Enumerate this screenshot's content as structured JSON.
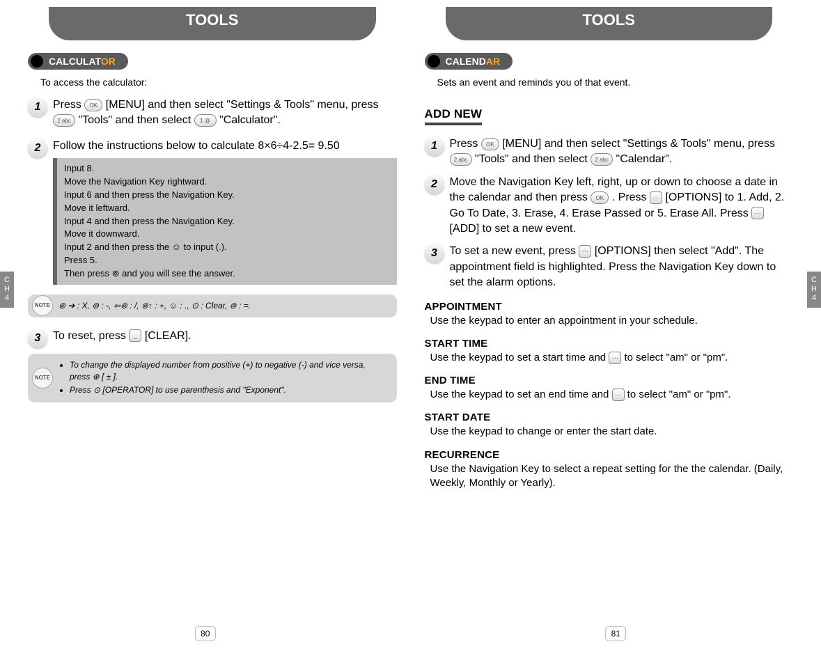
{
  "chapter_tab": "CH4",
  "left": {
    "header": "TOOLS",
    "section_label_a": "CALCULAT",
    "section_label_b": "OR",
    "intro": "To access the calculator:",
    "step1_a": "Press ",
    "step1_b": " [MENU] and then select \"Settings & Tools\" menu, press ",
    "step1_c": "\"Tools\" and then select ",
    "step1_d": "\"Calculator\".",
    "step2": "Follow the instructions below to calculate 8×6÷4-2.5= 9.50",
    "code": "Input 8.\nMove the Navigation Key rightward.\nInput 6 and then press the Navigation Key.\nMove it leftward.\nInput 4 and then press the Navigation Key.\nMove it downward.\nInput 2 and then press the ☺ to input (.).\nPress 5.\nThen press ⊚ and you will see the answer.",
    "note1": "⊚ ➔ : X,   ⊚ : -, ⇦⊚ : /,   ⊚↑ : +,  ☺ : .,  ⊙ : Clear,  ⊚ : =.",
    "step3_a": "To reset, press ",
    "step3_b": " [CLEAR].",
    "note2_bullet1": "To change the displayed number from positive (+) to negative (-) and vice versa, press ⊕ [ ± ].",
    "note2_bullet2": "Press  ⊙  [OPERATOR] to use parenthesis and \"Exponent\".",
    "page_num": "80",
    "key_ok": "OK",
    "key_2abc": "2 abc",
    "key_1": "1 @",
    "key_clr": "⎵"
  },
  "right": {
    "header": "TOOLS",
    "section_label_a": "CALEND",
    "section_label_b": "AR",
    "intro": "Sets an event and reminds you of that event.",
    "addnew": "ADD NEW",
    "step1_a": "Press ",
    "step1_b": " [MENU] and then select \"Settings & Tools\" menu, press ",
    "step1_c": "\"Tools\" and then select ",
    "step1_d": "\"Calendar\".",
    "step2_a": "Move the Navigation Key left, right, up or down to choose a date in the calendar and then press ",
    "step2_b": " . Press ",
    "step2_c": " [OPTIONS] to 1. Add, 2. Go To Date, 3. Erase, 4. Erase Passed or 5. Erase All. Press ",
    "step2_d": " [ADD] to set a new event.",
    "step3_a": "To set a new event, press ",
    "step3_b": " [OPTIONS] then select \"Add\". The appointment field is highlighted. Press the Navigation Key down to set the alarm options.",
    "h_appt": "APPOINTMENT",
    "t_appt": "Use the keypad to enter an appointment in your schedule.",
    "h_start": "START TIME",
    "t_start_a": "Use the keypad to set a start time and ",
    "t_start_b": " to select \"am\" or \"pm\".",
    "h_end": "END TIME",
    "t_end_a": "Use the keypad to set an end time and ",
    "t_end_b": " to select \"am\" or \"pm\".",
    "h_sdate": "START DATE",
    "t_sdate": "Use the keypad to change or enter the start date.",
    "h_recur": "RECURRENCE",
    "t_recur": "Use the Navigation Key to select a repeat setting for the the calendar. (Daily, Weekly, Monthly or Yearly).",
    "page_num": "81"
  }
}
